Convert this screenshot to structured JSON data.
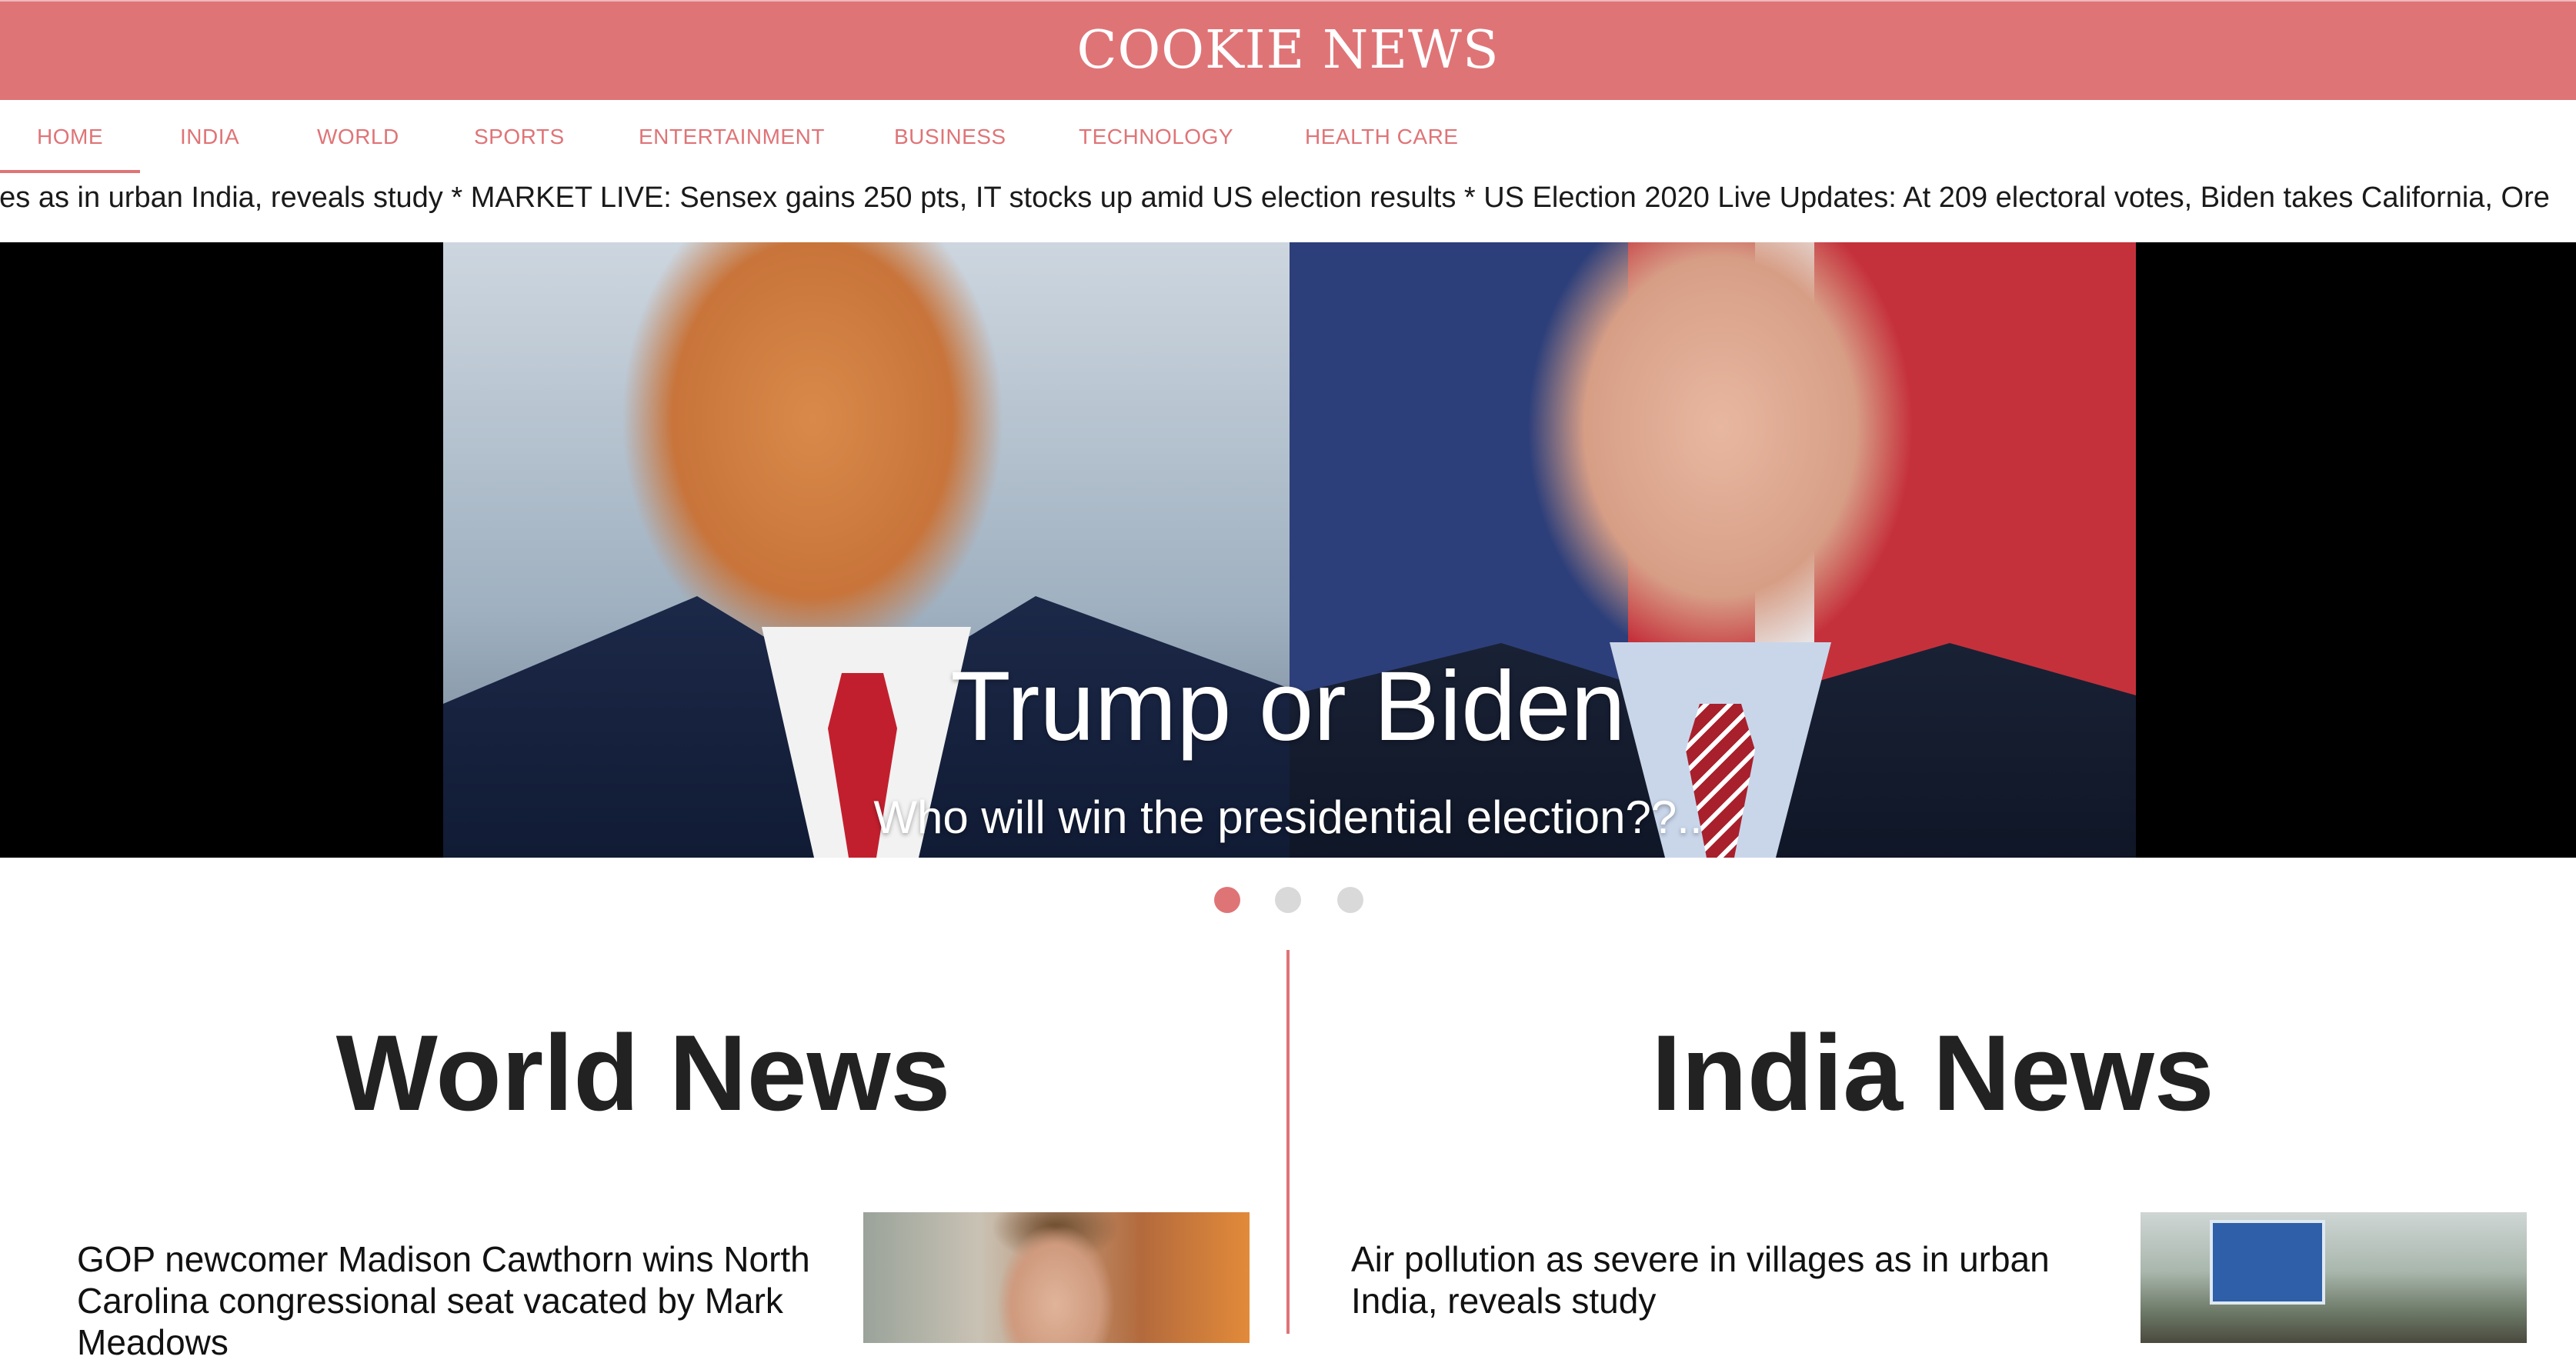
{
  "header": {
    "logo": "COOKIE NEWS"
  },
  "nav": {
    "items": [
      "HOME",
      "INDIA",
      "WORLD",
      "SPORTS",
      "ENTERTAINMENT",
      "BUSINESS",
      "TECHNOLOGY",
      "HEALTH CARE"
    ],
    "active": "HOME"
  },
  "ticker": {
    "text": "ges as in urban India, reveals study * MARKET LIVE: Sensex gains 250 pts, IT stocks up amid US election results * US Election 2020 Live Updates: At 209 electoral votes, Biden takes California, Ore"
  },
  "hero": {
    "title": "Trump or Biden",
    "subtitle": "Who will win the presidential election??..",
    "slide_count": 3,
    "active_slide": 1
  },
  "sections": {
    "world": {
      "title": "World News",
      "article_title": "GOP newcomer Madison Cawthorn wins North Carolina congressional seat vacated by Mark Meadows"
    },
    "india": {
      "title": "India News",
      "article_title": "Air pollution as severe in villages as in urban India, reveals study"
    }
  },
  "colors": {
    "brand": "#df7477",
    "dot_inactive": "#d9d9d9",
    "text": "#222222"
  }
}
